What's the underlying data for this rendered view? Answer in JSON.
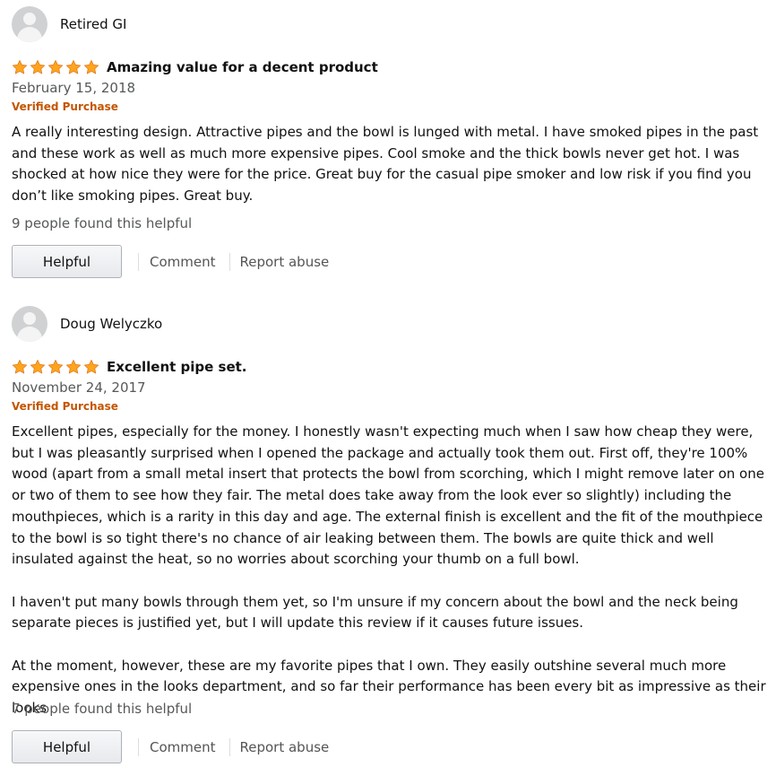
{
  "colors": {
    "star": "#ffa41c",
    "verified": "#c45500",
    "secondary_text": "#565959",
    "link_text": "#555555"
  },
  "reviews": [
    {
      "author": "Retired GI",
      "avatar_icon": "default-avatar-icon",
      "rating": 5,
      "max_rating": 5,
      "title": "Amazing value for a decent product",
      "date": "February 15, 2018",
      "verified": "Verified Purchase",
      "paragraphs": [
        "A really interesting design. Attractive pipes and the bowl is lunged with metal. I have smoked pipes in the past and these work as well as much more expensive pipes. Cool smoke and the thick bowls never get hot. I was shocked at how nice they were for the price. Great buy for the casual pipe smoker and low risk if you find you don’t like smoking pipes. Great buy."
      ],
      "helpful_count": "9 people found this helpful",
      "helpful_label": "Helpful",
      "comment_label": "Comment",
      "report_label": "Report abuse"
    },
    {
      "author": "Doug Welyczko",
      "avatar_icon": "default-avatar-icon",
      "rating": 5,
      "max_rating": 5,
      "title": "Excellent pipe set.",
      "date": "November 24, 2017",
      "verified": "Verified Purchase",
      "paragraphs": [
        "Excellent pipes, especially for the money. I honestly wasn't expecting much when I saw how cheap they were, but I was pleasantly surprised when I opened the package and actually took them out. First off, they're 100% wood (apart from a small metal insert that protects the bowl from scorching, which I might remove later on one or two of them to see how they fair. The metal does take away from the look ever so slightly) including the mouthpieces, which is a rarity in this day and age. The external finish is excellent and the fit of the mouthpiece to the bowl is so tight there's no chance of air leaking between them. The bowls are quite thick and well insulated against the heat, so no worries about scorching your thumb on a full bowl.",
        "I haven't put many bowls through them yet, so I'm unsure if my concern about the bowl and the neck being separate pieces is justified yet, but I will update this review if it causes future issues.",
        "At the moment, however, these are my favorite pipes that I own. They easily outshine several much more expensive ones in the looks department, and so far their performance has been every bit as impressive as their looks"
      ],
      "helpful_count": "7 people found this helpful",
      "helpful_label": "Helpful",
      "comment_label": "Comment",
      "report_label": "Report abuse"
    }
  ]
}
